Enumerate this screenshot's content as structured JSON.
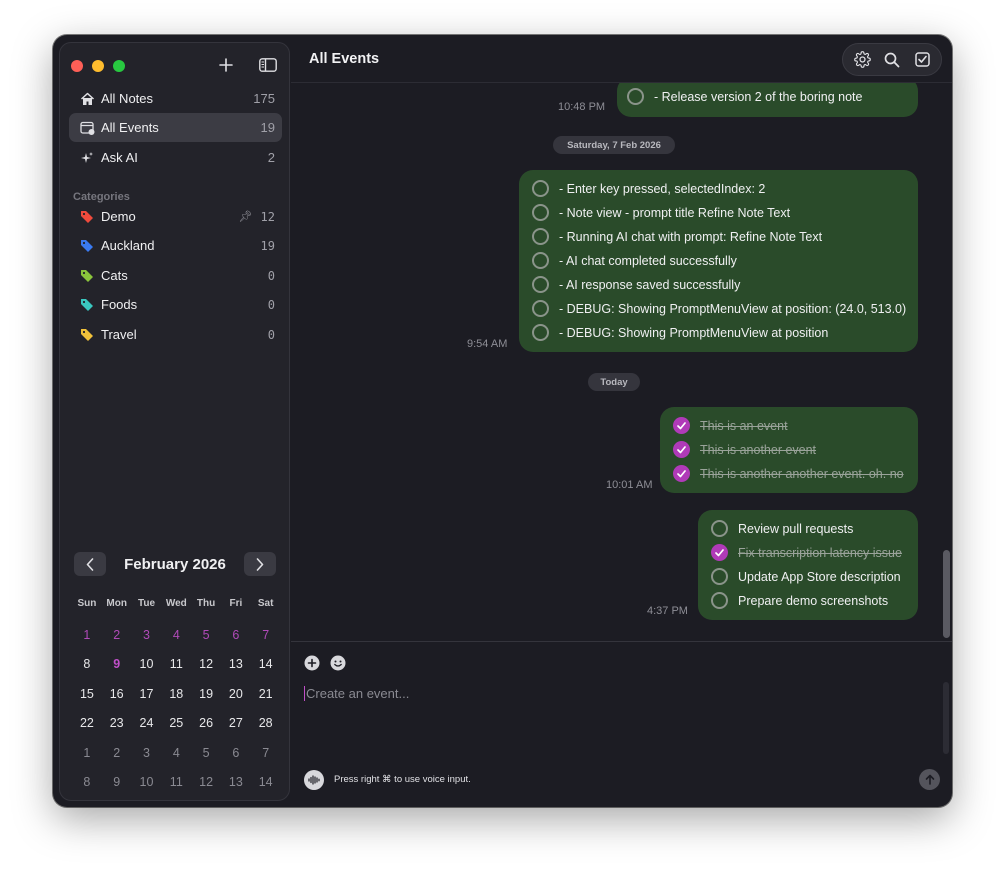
{
  "sidebar": {
    "nav": [
      {
        "label": "All Notes",
        "count": "175",
        "icon": "house-icon"
      },
      {
        "label": "All Events",
        "count": "19",
        "icon": "calendar-events-icon"
      },
      {
        "label": "Ask AI",
        "count": "2",
        "icon": "sparkles-icon"
      }
    ],
    "categories_label": "Categories",
    "categories": [
      {
        "label": "Demo",
        "count": "12",
        "color": "#ef4a3c",
        "pinned": true
      },
      {
        "label": "Auckland",
        "count": "19",
        "color": "#3a7bf2"
      },
      {
        "label": "Cats",
        "count": "0",
        "color": "#8bc43c"
      },
      {
        "label": "Foods",
        "count": "0",
        "color": "#3ac8c0"
      },
      {
        "label": "Travel",
        "count": "0",
        "color": "#f2c23a"
      }
    ],
    "calendar": {
      "title": "February 2026",
      "weekdays": [
        "Sun",
        "Mon",
        "Tue",
        "Wed",
        "Thu",
        "Fri",
        "Sat"
      ],
      "weeks": [
        [
          "1",
          "2",
          "3",
          "4",
          "5",
          "6",
          "7"
        ],
        [
          "8",
          "9",
          "10",
          "11",
          "12",
          "13",
          "14"
        ],
        [
          "15",
          "16",
          "17",
          "18",
          "19",
          "20",
          "21"
        ],
        [
          "22",
          "23",
          "24",
          "25",
          "26",
          "27",
          "28"
        ],
        [
          "1",
          "2",
          "3",
          "4",
          "5",
          "6",
          "7"
        ],
        [
          "8",
          "9",
          "10",
          "11",
          "12",
          "13",
          "14"
        ]
      ]
    }
  },
  "main": {
    "title": "All Events",
    "groups": [
      {
        "time": "10:48 PM",
        "tasks": [
          {
            "text": "- Release version 2 of the boring note",
            "done": false
          }
        ]
      },
      {
        "date": "Saturday, 7 Feb 2026"
      },
      {
        "time": "9:54 AM",
        "tasks": [
          {
            "text": "- Enter key pressed, selectedIndex: 2",
            "done": false
          },
          {
            "text": "- Note view - prompt title Refine Note Text",
            "done": false
          },
          {
            "text": "- Running AI chat with prompt: Refine Note Text",
            "done": false
          },
          {
            "text": "- AI chat completed successfully",
            "done": false
          },
          {
            "text": "- AI response saved successfully",
            "done": false
          },
          {
            "text": "- DEBUG: Showing PromptMenuView at position: (24.0, 513.0)",
            "done": false
          },
          {
            "text": "- DEBUG: Showing PromptMenuView at position",
            "done": false
          }
        ]
      },
      {
        "date": "Today"
      },
      {
        "time": "10:01 AM",
        "tasks": [
          {
            "text": "This is an event",
            "done": true
          },
          {
            "text": "This is another event",
            "done": true
          },
          {
            "text": "This is another another event. oh. no",
            "done": true
          }
        ]
      },
      {
        "time": "4:37 PM",
        "tasks": [
          {
            "text": "Review pull requests",
            "done": false
          },
          {
            "text": "Fix transcription latency issue",
            "done": true
          },
          {
            "text": "Update App Store description",
            "done": false
          },
          {
            "text": "Prepare demo screenshots",
            "done": false
          }
        ]
      }
    ],
    "composer": {
      "placeholder": "Create an event...",
      "voice_hint": "Press right ⌘ to use voice input."
    }
  },
  "colors": {
    "accent": "#c04fc8",
    "bubble": "#2a4b2a"
  }
}
